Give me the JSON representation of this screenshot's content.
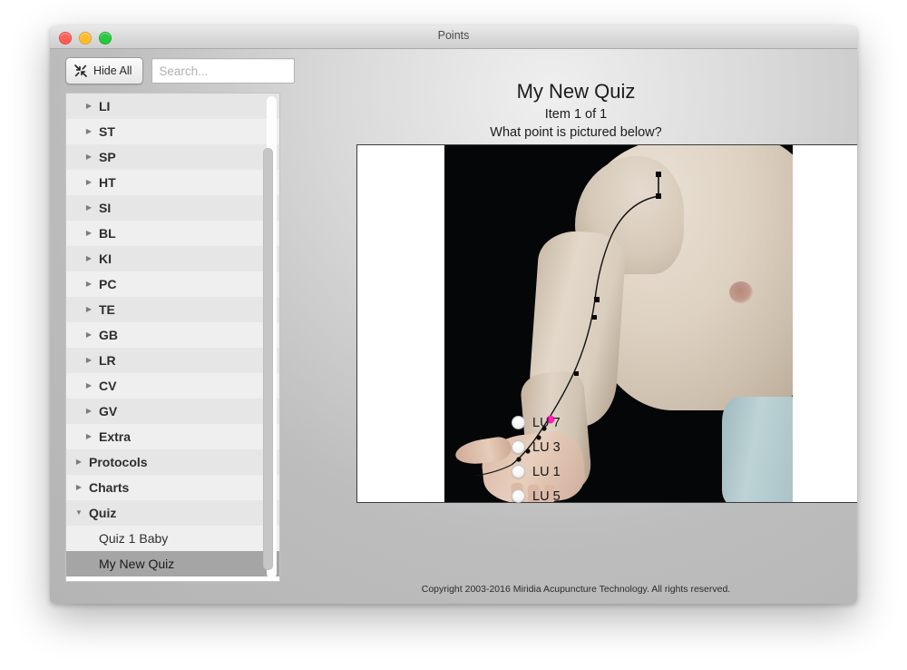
{
  "window": {
    "title": "Points",
    "controls": [
      {
        "name": "close",
        "color": "#ff5f57"
      },
      {
        "name": "minimize",
        "color": "#ffbd2e"
      },
      {
        "name": "zoom",
        "color": "#28c840"
      }
    ]
  },
  "toolbar": {
    "hide_all_label": "Hide All",
    "hide_all_icon": "collapse-arrows-icon",
    "search_placeholder": "Search...",
    "search_value": ""
  },
  "sidebar": {
    "items": [
      {
        "label": "LI",
        "level": 2,
        "disclosure": "collapsed",
        "selected": false
      },
      {
        "label": "ST",
        "level": 2,
        "disclosure": "collapsed",
        "selected": false
      },
      {
        "label": "SP",
        "level": 2,
        "disclosure": "collapsed",
        "selected": false
      },
      {
        "label": "HT",
        "level": 2,
        "disclosure": "collapsed",
        "selected": false
      },
      {
        "label": "SI",
        "level": 2,
        "disclosure": "collapsed",
        "selected": false
      },
      {
        "label": "BL",
        "level": 2,
        "disclosure": "collapsed",
        "selected": false
      },
      {
        "label": "KI",
        "level": 2,
        "disclosure": "collapsed",
        "selected": false
      },
      {
        "label": "PC",
        "level": 2,
        "disclosure": "collapsed",
        "selected": false
      },
      {
        "label": "TE",
        "level": 2,
        "disclosure": "collapsed",
        "selected": false
      },
      {
        "label": "GB",
        "level": 2,
        "disclosure": "collapsed",
        "selected": false
      },
      {
        "label": "LR",
        "level": 2,
        "disclosure": "collapsed",
        "selected": false
      },
      {
        "label": "CV",
        "level": 2,
        "disclosure": "collapsed",
        "selected": false
      },
      {
        "label": "GV",
        "level": 2,
        "disclosure": "collapsed",
        "selected": false
      },
      {
        "label": "Extra",
        "level": 2,
        "disclosure": "collapsed",
        "selected": false
      },
      {
        "label": "Protocols",
        "level": 1,
        "disclosure": "collapsed",
        "selected": false
      },
      {
        "label": "Charts",
        "level": 1,
        "disclosure": "collapsed",
        "selected": false
      },
      {
        "label": "Quiz",
        "level": 1,
        "disclosure": "expanded",
        "selected": false
      },
      {
        "label": "Quiz 1 Baby",
        "level": 2,
        "disclosure": "none",
        "selected": false
      },
      {
        "label": "My New Quiz",
        "level": 2,
        "disclosure": "none",
        "selected": true
      }
    ],
    "scrollbar": {
      "orientation": "vertical",
      "thumb_position": "middle"
    }
  },
  "quiz": {
    "title": "My New Quiz",
    "progress": "Item 1 of 1",
    "prompt": "What point is pictured below?",
    "image": {
      "alt": "Photograph of a bare torso and left arm with the Lung meridian pathway drawn, one point highlighted in magenta",
      "highlight_color": "#ff22bb",
      "line_color": "#111111",
      "background": "#050608"
    },
    "options": [
      {
        "label": "LU 7",
        "selected": false
      },
      {
        "label": "LU 3",
        "selected": false
      },
      {
        "label": "LU 1",
        "selected": false
      },
      {
        "label": "LU 5",
        "selected": false
      }
    ]
  },
  "footer": {
    "copyright": "Copyright 2003-2016 Miridia Acupuncture Technology.  All rights reserved."
  }
}
